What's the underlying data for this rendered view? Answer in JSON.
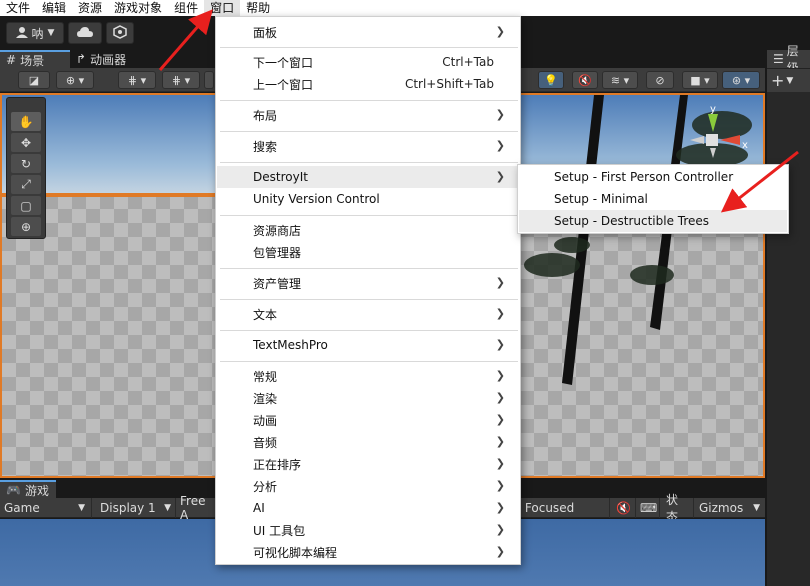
{
  "menubar": {
    "items": [
      "文件",
      "编辑",
      "资源",
      "游戏对象",
      "组件",
      "窗口",
      "帮助"
    ],
    "active_index": 5
  },
  "toolbar": {
    "account_label": "呐"
  },
  "scene_tabs": {
    "scene": "场景",
    "animator": "动画器"
  },
  "right_panel": {
    "tab_label": "层级"
  },
  "game_tab": {
    "label": "游戏"
  },
  "game_bar": {
    "view_mode": "Game",
    "display": "Display 1",
    "aspect": "Free A",
    "play_focus": "y Focused",
    "stats": "状态",
    "gizmos": "Gizmos"
  },
  "gizmo": {
    "axis_y": "y",
    "axis_x": "x"
  },
  "window_menu": {
    "items": [
      {
        "label": "面板",
        "shortcut": "",
        "submenu": true
      },
      {
        "label": "下一个窗口",
        "shortcut": "Ctrl+Tab",
        "submenu": false
      },
      {
        "label": "上一个窗口",
        "shortcut": "Ctrl+Shift+Tab",
        "submenu": false
      },
      {
        "label": "布局",
        "shortcut": "",
        "submenu": true
      },
      {
        "label": "搜索",
        "shortcut": "",
        "submenu": true
      },
      {
        "label": "DestroyIt",
        "shortcut": "",
        "submenu": true
      },
      {
        "label": "Unity Version Control",
        "shortcut": "",
        "submenu": false
      },
      {
        "label": "资源商店",
        "shortcut": "",
        "submenu": false
      },
      {
        "label": "包管理器",
        "shortcut": "",
        "submenu": false
      },
      {
        "label": "资产管理",
        "shortcut": "",
        "submenu": true
      },
      {
        "label": "文本",
        "shortcut": "",
        "submenu": true
      },
      {
        "label": "TextMeshPro",
        "shortcut": "",
        "submenu": true
      },
      {
        "label": "常规",
        "shortcut": "",
        "submenu": true
      },
      {
        "label": "渲染",
        "shortcut": "",
        "submenu": true
      },
      {
        "label": "动画",
        "shortcut": "",
        "submenu": true
      },
      {
        "label": "音频",
        "shortcut": "",
        "submenu": true
      },
      {
        "label": "正在排序",
        "shortcut": "",
        "submenu": true
      },
      {
        "label": "分析",
        "shortcut": "",
        "submenu": true
      },
      {
        "label": "AI",
        "shortcut": "",
        "submenu": true
      },
      {
        "label": "UI 工具包",
        "shortcut": "",
        "submenu": true
      },
      {
        "label": "可视化脚本编程",
        "shortcut": "",
        "submenu": true
      }
    ]
  },
  "destroyit_submenu": {
    "items": [
      "Setup - First Person Controller",
      "Setup - Minimal",
      "Setup - Destructible Trees"
    ]
  },
  "colors": {
    "accent_orange": "#e07a26",
    "annotation_red": "#e8201e",
    "selection_blue": "#5a9fe0"
  }
}
